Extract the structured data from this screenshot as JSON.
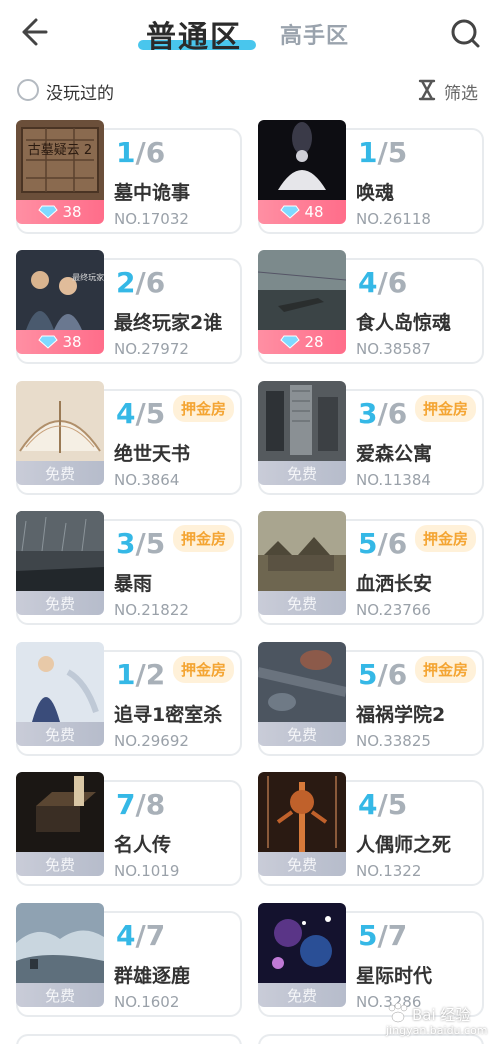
{
  "header": {
    "tab_normal": "普通区",
    "tab_expert": "高手区",
    "accent": "#3fc3ec"
  },
  "filter": {
    "unplayed_label": "没玩过的",
    "filter_label": "筛选"
  },
  "cards": [
    {
      "played": "1",
      "total": "6",
      "title": "墓中诡事",
      "no": "NO.17032",
      "band": "38",
      "band_type": "gem",
      "deposit": ""
    },
    {
      "played": "1",
      "total": "5",
      "title": "唤魂",
      "no": "NO.26118",
      "band": "48",
      "band_type": "gem",
      "deposit": ""
    },
    {
      "played": "2",
      "total": "6",
      "title": "最终玩家2谁",
      "no": "NO.27972",
      "band": "38",
      "band_type": "gem",
      "deposit": ""
    },
    {
      "played": "4",
      "total": "6",
      "title": "食人岛惊魂",
      "no": "NO.38587",
      "band": "28",
      "band_type": "gem",
      "deposit": ""
    },
    {
      "played": "4",
      "total": "5",
      "title": "绝世天书",
      "no": "NO.3864",
      "band": "免费",
      "band_type": "free",
      "deposit": "押金房"
    },
    {
      "played": "3",
      "total": "6",
      "title": "爱森公寓",
      "no": "NO.11384",
      "band": "免费",
      "band_type": "free",
      "deposit": "押金房"
    },
    {
      "played": "3",
      "total": "5",
      "title": "暴雨",
      "no": "NO.21822",
      "band": "免费",
      "band_type": "free",
      "deposit": "押金房"
    },
    {
      "played": "5",
      "total": "6",
      "title": "血洒长安",
      "no": "NO.23766",
      "band": "免费",
      "band_type": "free",
      "deposit": "押金房"
    },
    {
      "played": "1",
      "total": "2",
      "title": "追寻1密室杀",
      "no": "NO.29692",
      "band": "免费",
      "band_type": "free",
      "deposit": "押金房"
    },
    {
      "played": "5",
      "total": "6",
      "title": "福祸学院2",
      "no": "NO.33825",
      "band": "免费",
      "band_type": "free",
      "deposit": "押金房"
    },
    {
      "played": "7",
      "total": "8",
      "title": "名人传",
      "no": "NO.1019",
      "band": "免费",
      "band_type": "free",
      "deposit": ""
    },
    {
      "played": "4",
      "total": "5",
      "title": "人偶师之死",
      "no": "NO.1322",
      "band": "免费",
      "band_type": "free",
      "deposit": ""
    },
    {
      "played": "4",
      "total": "7",
      "title": "群雄逐鹿",
      "no": "NO.1602",
      "band": "免费",
      "band_type": "free",
      "deposit": ""
    },
    {
      "played": "5",
      "total": "7",
      "title": "星际时代",
      "no": "NO.3286",
      "band": "免费",
      "band_type": "free",
      "deposit": ""
    }
  ],
  "cover_text": {
    "card0": "古墓疑云 2",
    "card2": "最终玩家 2"
  },
  "watermark": {
    "text": "Bai 经验",
    "sub": "jingyan.baidu.com"
  },
  "colors": {
    "count_accent": "#35b8e6",
    "deposit_text": "#f4a533",
    "deposit_bg": "#fff1d9",
    "gem_band": "#ff7d96",
    "free_band": "#bcc1cf"
  },
  "icons": {
    "back": "arrow-left-icon",
    "search": "search-icon",
    "filter": "hourglass-icon",
    "gem": "diamond-icon"
  }
}
